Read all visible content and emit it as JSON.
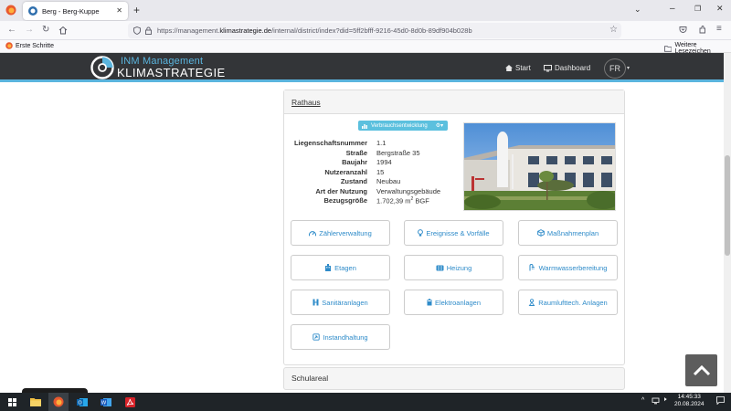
{
  "browser": {
    "tab_title": "Berg - Berg-Kuppe",
    "url_prefix": "https://management.",
    "url_domain": "klimastrategie.de",
    "url_path": "/internal/district/index?did=5ff2bfff-9216-45d0-8d0b-89df904b028b",
    "bookmark_first": "Erste Schritte",
    "bookmark_other": "Weitere Lesezeichen"
  },
  "app": {
    "brand_line1": "INM Management",
    "brand_line2": "KLIMASTRATEGIE",
    "nav_start": "Start",
    "nav_dashboard": "Dashboard",
    "user_initials": "FR"
  },
  "building": {
    "title": "Rathaus",
    "consumption_button": "Verbrauchsentwicklung",
    "fields": [
      {
        "label": "Liegenschaftsnummer",
        "value": "1.1"
      },
      {
        "label": "Straße",
        "value": "Bergstraße 35"
      },
      {
        "label": "Baujahr",
        "value": "1994"
      },
      {
        "label": "Nutzeranzahl",
        "value": "15"
      },
      {
        "label": "Zustand",
        "value": "Neubau"
      },
      {
        "label": "Art der Nutzung",
        "value": "Verwaltungsgebäude"
      }
    ],
    "area_label": "Bezugsgröße",
    "area_number": "1.702,39 m",
    "area_sup": "2",
    "area_unit": " BGF"
  },
  "actions": [
    {
      "label": "Zählerverwaltung",
      "icon": "gauge-icon"
    },
    {
      "label": "Ereignisse & Vorfälle",
      "icon": "lightbulb-icon"
    },
    {
      "label": "Maßnahmenplan",
      "icon": "cube-icon"
    },
    {
      "label": "Etagen",
      "icon": "building-icon"
    },
    {
      "label": "Heizung",
      "icon": "heater-icon"
    },
    {
      "label": "Warmwasserbereitung",
      "icon": "shower-icon"
    },
    {
      "label": "Sanitäranlagen",
      "icon": "sanitary-icon"
    },
    {
      "label": "Elektroanlagen",
      "icon": "battery-icon"
    },
    {
      "label": "Raumlufttech. Anlagen",
      "icon": "fan-icon"
    },
    {
      "label": "Instandhaltung",
      "icon": "wrench-icon"
    }
  ],
  "next_section": "Schulareal",
  "taskbar": {
    "time": "14:45:33",
    "date": "20.08.2024"
  },
  "colors": {
    "accent": "#5ab4dd",
    "link": "#2e8bc9",
    "header": "#333538",
    "info_button": "#5bc0de"
  }
}
